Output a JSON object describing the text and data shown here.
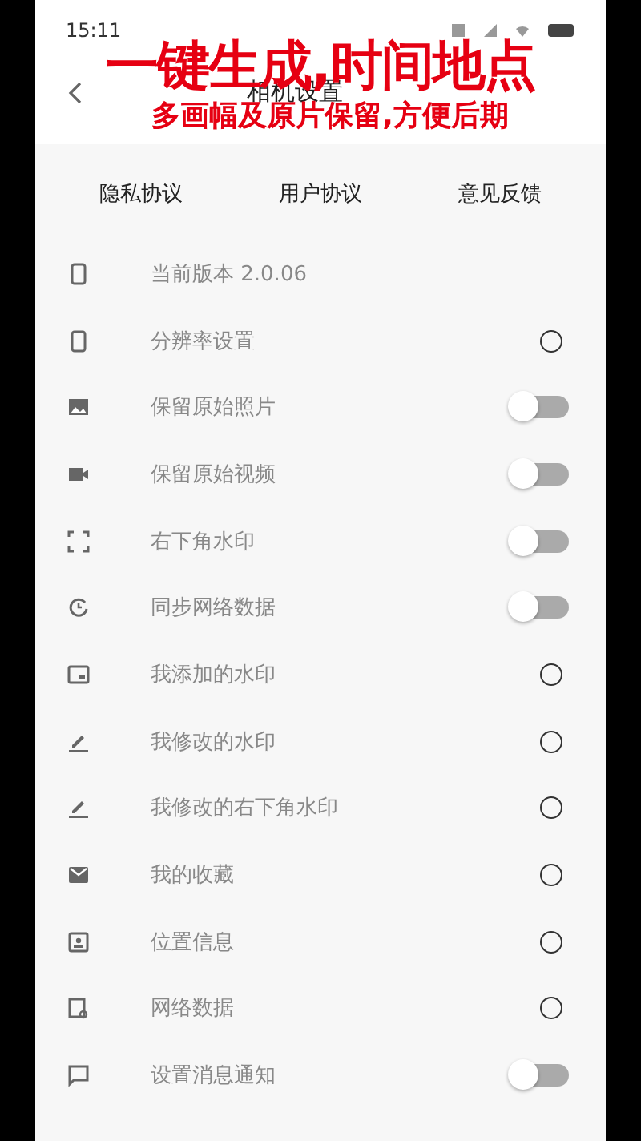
{
  "status_bar": {
    "time": "15:11"
  },
  "header": {
    "title": "相机设置"
  },
  "promo": {
    "headline": "一键生成,时间地点",
    "subline": "多画幅及原片保留,方便后期"
  },
  "tabs": [
    {
      "label": "隐私协议"
    },
    {
      "label": "用户协议"
    },
    {
      "label": "意见反馈"
    }
  ],
  "settings": [
    {
      "label": "当前版本 2.0.06",
      "kind": "info"
    },
    {
      "label": "分辨率设置",
      "kind": "radio",
      "selected": false
    },
    {
      "label": "保留原始照片",
      "kind": "toggle",
      "on": false
    },
    {
      "label": "保留原始视频",
      "kind": "toggle",
      "on": false
    },
    {
      "label": "右下角水印",
      "kind": "toggle",
      "on": false
    },
    {
      "label": "同步网络数据",
      "kind": "toggle",
      "on": false
    },
    {
      "label": "我添加的水印",
      "kind": "radio",
      "selected": false
    },
    {
      "label": "我修改的水印",
      "kind": "radio",
      "selected": false
    },
    {
      "label": "我修改的右下角水印",
      "kind": "radio",
      "selected": false
    },
    {
      "label": "我的收藏",
      "kind": "radio",
      "selected": false
    },
    {
      "label": "位置信息",
      "kind": "radio",
      "selected": false
    },
    {
      "label": "网络数据",
      "kind": "radio",
      "selected": false
    },
    {
      "label": "设置消息通知",
      "kind": "toggle",
      "on": false
    }
  ]
}
